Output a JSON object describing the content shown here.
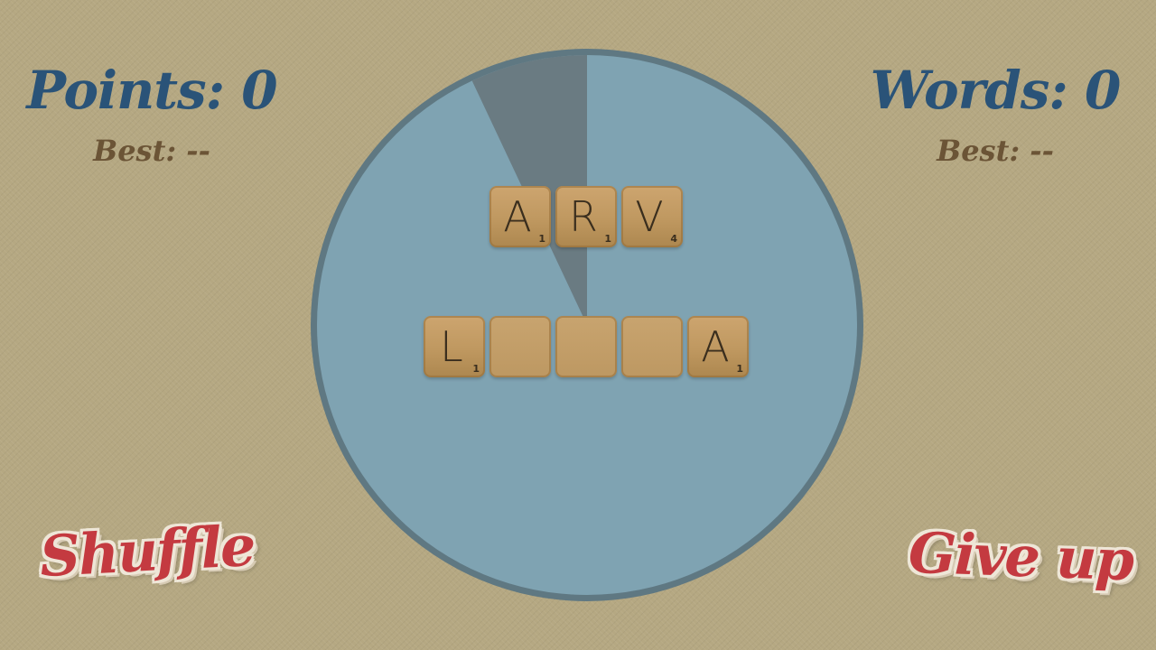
{
  "colors": {
    "background": "#b5a882",
    "score_text": "#2a5378",
    "best_text": "#6b5436",
    "timer_fill": "#7fa3b2",
    "timer_border": "#5f7882",
    "timer_elapsed": "#6a7b82",
    "button_text": "#c43a40"
  },
  "scores": {
    "points_label": "Points: 0",
    "points_best": "Best: --",
    "words_label": "Words: 0",
    "words_best": "Best: --"
  },
  "timer": {
    "remaining_fraction": 0.93
  },
  "rack": {
    "row1": [
      {
        "letter": "A",
        "score": "1"
      },
      {
        "letter": "R",
        "score": "1"
      },
      {
        "letter": "V",
        "score": "4"
      }
    ],
    "row2": [
      {
        "letter": "L",
        "score": "1"
      },
      {
        "letter": "",
        "score": ""
      },
      {
        "letter": "",
        "score": ""
      },
      {
        "letter": "",
        "score": ""
      },
      {
        "letter": "A",
        "score": "1"
      }
    ]
  },
  "buttons": {
    "shuffle": "Shuffle",
    "give_up": "Give up"
  }
}
